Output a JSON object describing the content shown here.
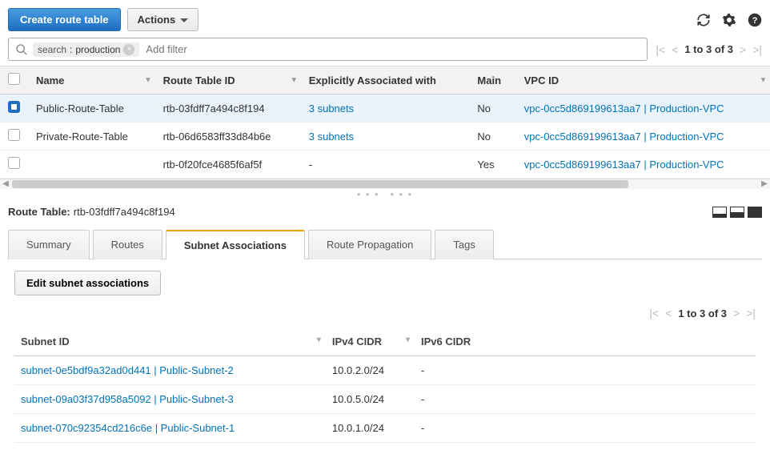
{
  "toolbar": {
    "create_label": "Create route table",
    "actions_label": "Actions"
  },
  "search": {
    "tag_key": "search",
    "tag_value": "production",
    "placeholder": "Add filter"
  },
  "pager_top": {
    "text": "1 to 3 of 3"
  },
  "table": {
    "headers": {
      "name": "Name",
      "rtid": "Route Table ID",
      "assoc": "Explicitly Associated with",
      "main": "Main",
      "vpc": "VPC ID"
    },
    "rows": [
      {
        "selected": true,
        "name": "Public-Route-Table",
        "rtid": "rtb-03fdff7a494c8f194",
        "assoc": "3 subnets",
        "main": "No",
        "vpc": "vpc-0cc5d869199613aa7 | Production-VPC"
      },
      {
        "selected": false,
        "name": "Private-Route-Table",
        "rtid": "rtb-06d6583ff33d84b6e",
        "assoc": "3 subnets",
        "main": "No",
        "vpc": "vpc-0cc5d869199613aa7 | Production-VPC"
      },
      {
        "selected": false,
        "name": "",
        "rtid": "rtb-0f20fce4685f6af5f",
        "assoc": "-",
        "main": "Yes",
        "vpc": "vpc-0cc5d869199613aa7 | Production-VPC"
      }
    ]
  },
  "detail": {
    "label": "Route Table:",
    "value": "rtb-03fdff7a494c8f194"
  },
  "tabs": {
    "summary": "Summary",
    "routes": "Routes",
    "subnets": "Subnet Associations",
    "prop": "Route Propagation",
    "tags": "Tags"
  },
  "subnet_section": {
    "edit_label": "Edit subnet associations",
    "pager": {
      "text": "1 to 3 of 3"
    },
    "headers": {
      "subnet": "Subnet ID",
      "ipv4": "IPv4 CIDR",
      "ipv6": "IPv6 CIDR"
    },
    "rows": [
      {
        "subnet": "subnet-0e5bdf9a32ad0d441 | Public-Subnet-2",
        "ipv4": "10.0.2.0/24",
        "ipv6": "-"
      },
      {
        "subnet": "subnet-09a03f37d958a5092 | Public-Subnet-3",
        "ipv4": "10.0.5.0/24",
        "ipv6": "-"
      },
      {
        "subnet": "subnet-070c92354cd216c6e | Public-Subnet-1",
        "ipv4": "10.0.1.0/24",
        "ipv6": "-"
      }
    ]
  }
}
